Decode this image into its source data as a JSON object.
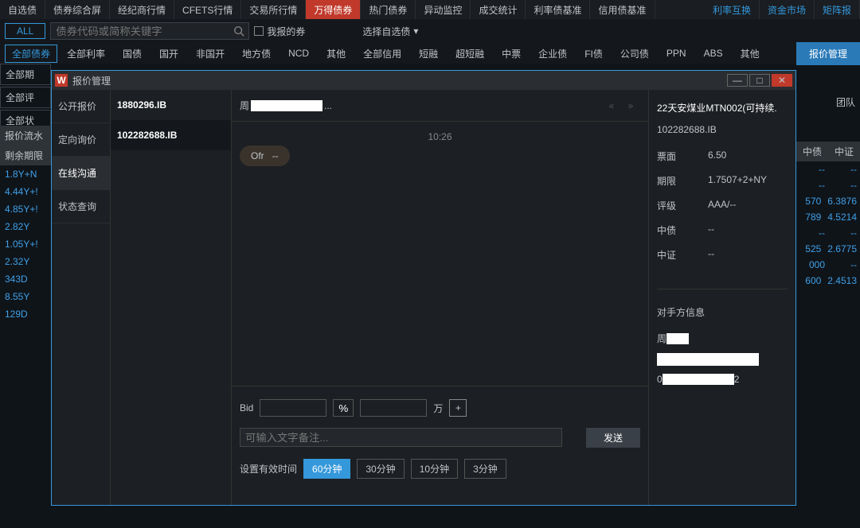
{
  "topTabs": [
    "自选债",
    "债券综合屏",
    "经纪商行情",
    "CFETS行情",
    "交易所行情",
    "万得债券",
    "热门债券",
    "异动监控",
    "成交统计",
    "利率债基准",
    "信用债基准"
  ],
  "topTabsActiveIndex": 5,
  "topRight": [
    "利率互换",
    "资金市场",
    "矩阵报"
  ],
  "filter": {
    "all": "ALL",
    "searchPlaceholder": "债券代码或简称关键字",
    "myQuote": "我报的券",
    "selectFav": "选择自选债"
  },
  "cats": {
    "first": "全部债券",
    "items": [
      "全部利率",
      "国债",
      "国开",
      "非国开",
      "地方债",
      "NCD",
      "其他",
      "全部信用",
      "短融",
      "超短融",
      "中票",
      "企业债",
      "FI债",
      "公司债",
      "PPN",
      "ABS",
      "其他"
    ],
    "mgmt": "报价管理"
  },
  "leftBtns": [
    "全部期",
    "全部评",
    "全部状"
  ],
  "tableHdr": [
    "报价流水",
    "剩余期限"
  ],
  "rows": [
    "1.8Y+N",
    "4.44Y+!",
    "4.85Y+!",
    "2.82Y",
    "1.05Y+!",
    "2.32Y",
    "343D",
    "8.55Y",
    "129D"
  ],
  "rightHdr": [
    "中债",
    "中证"
  ],
  "rightRows": [
    [
      "--",
      "--"
    ],
    [
      "--",
      "--"
    ],
    [
      "570",
      "6.3876"
    ],
    [
      "789",
      "4.5214"
    ],
    [
      "--",
      "--"
    ],
    [
      "525",
      "2.6775"
    ],
    [
      "000",
      "--"
    ],
    [
      "600",
      "2.4513"
    ]
  ],
  "team": "团队",
  "modal": {
    "title": "报价管理",
    "nav": [
      "公开报价",
      "定向询价",
      "在线沟通",
      "状态查询"
    ],
    "navActive": 2,
    "list": [
      "1880296.IB",
      "102282688.IB"
    ],
    "listSelected": 1,
    "chatNamePrefix": "周",
    "chatNameSuffix": "...",
    "timestamp": "10:26",
    "bubble": {
      "label": "Ofr",
      "val": "--"
    },
    "bidLabel": "Bid",
    "pct": "%",
    "wan": "万",
    "remarkPlaceholder": "可输入文字备注...",
    "send": "发送",
    "timeLabel": "设置有效时间",
    "timeBtns": [
      "60分钟",
      "30分钟",
      "10分钟",
      "3分钟"
    ],
    "timeActive": 0,
    "bond": {
      "name": "22天安煤业MTN002(可持续.",
      "code": "102282688.IB",
      "kv": [
        {
          "k": "票面",
          "v": "6.50"
        },
        {
          "k": "期限",
          "v": "1.7507+2+NY"
        },
        {
          "k": "评级",
          "v": "AAA/--"
        },
        {
          "k": "中债",
          "v": "--"
        },
        {
          "k": "中证",
          "v": "--"
        }
      ]
    },
    "cp": {
      "title": "对手方信息",
      "namePrefix": "周",
      "row3prefix": "0",
      "row3suffix": "2"
    }
  }
}
